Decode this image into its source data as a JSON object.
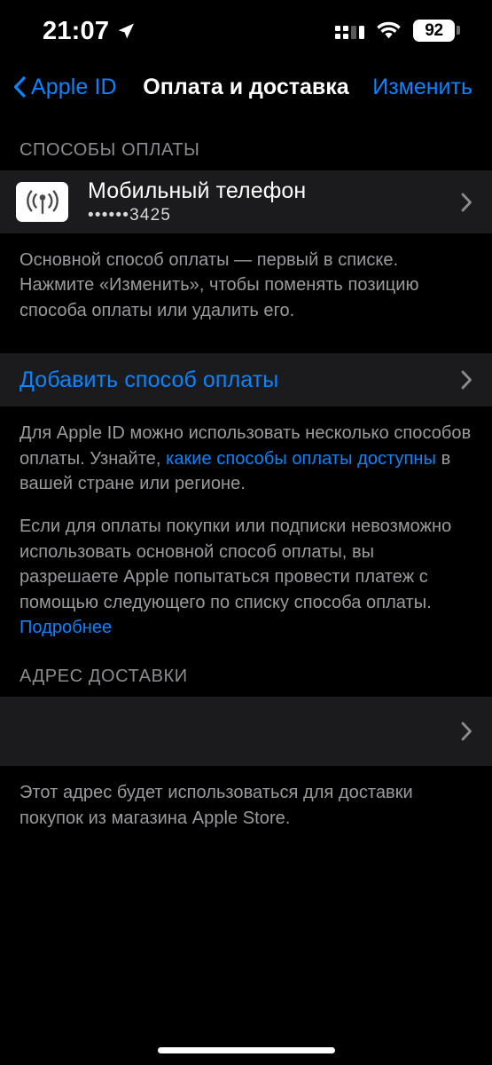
{
  "status_bar": {
    "time": "21:07",
    "location_icon": "location-arrow-icon",
    "signal_icon": "cellular-signal-icon",
    "wifi_icon": "wifi-icon",
    "battery_level": "92",
    "battery_icon": "battery-icon"
  },
  "nav": {
    "back_icon": "chevron-left-icon",
    "back_label": "Apple ID",
    "title": "Оплата и доставка",
    "action_label": "Изменить"
  },
  "payment_section": {
    "header": "СПОСОБЫ ОПЛАТЫ",
    "method": {
      "icon": "cell-antenna-icon",
      "title": "Мобильный телефон",
      "subtitle": "••••••3425",
      "chevron_icon": "chevron-right-icon"
    },
    "footnote": "Основной способ оплаты — первый в списке. Нажмите «Изменить», чтобы поменять позицию способа оплаты или удалить его.",
    "add_row": {
      "label": "Добавить способ оплаты",
      "chevron_icon": "chevron-right-icon"
    },
    "footnote2_part1": "Для Apple ID можно использовать несколько способов оплаты. Узнайте, ",
    "footnote2_link": "какие способы оплаты доступны",
    "footnote2_part2": " в вашей стране или регионе.",
    "footnote3_part1": "Если для оплаты покупки или подписки невозможно использовать основной способ оплаты, вы разрешаете Apple попытаться провести платеж с помощью следующего по списку способа оплаты. ",
    "footnote3_link": "Подробнее"
  },
  "shipping_section": {
    "header": "АДРЕС ДОСТАВКИ",
    "address_row": {
      "value": "",
      "chevron_icon": "chevron-right-icon"
    },
    "footnote": "Этот адрес будет использоваться для доставки покупок из магазина Apple Store."
  },
  "colors": {
    "background": "#000000",
    "row_background": "#1b1b1d",
    "accent_blue": "#0a84ff",
    "secondary_text": "#9b9b9f",
    "header_text": "#8b8b90"
  }
}
